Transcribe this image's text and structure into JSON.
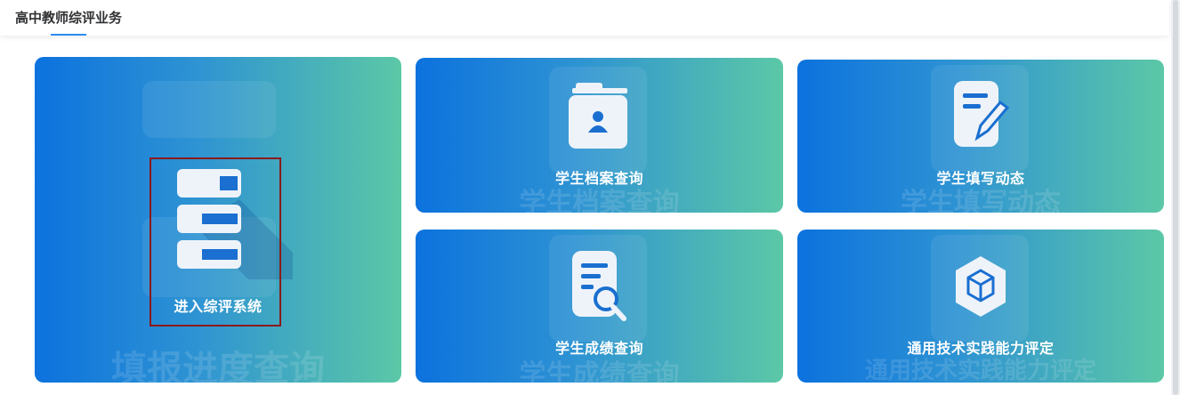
{
  "header": {
    "tab_title": "高中教师综评业务"
  },
  "cards": {
    "enter_system": {
      "label": "进入综评系统",
      "watermark": "填报进度查询"
    },
    "archive_query": {
      "label": "学生档案查询",
      "watermark": "学生档案查询"
    },
    "fill_status": {
      "label": "学生填写动态",
      "watermark": "学生填写动态"
    },
    "grade_query": {
      "label": "学生成绩查询",
      "watermark": "学生成绩查询"
    },
    "tech_practice": {
      "label": "通用技术实践能力评定",
      "watermark": "通用技术实践能力评定"
    }
  },
  "icons": [
    "server-stack-icon",
    "student-folder-icon",
    "edit-document-icon",
    "search-document-icon",
    "cube-hexagon-icon"
  ],
  "colors": {
    "gradient_start": "#0c72de",
    "gradient_end": "#5cc8a6",
    "tab_accent": "#2d8cf0",
    "highlight": "#8b1a1a"
  }
}
